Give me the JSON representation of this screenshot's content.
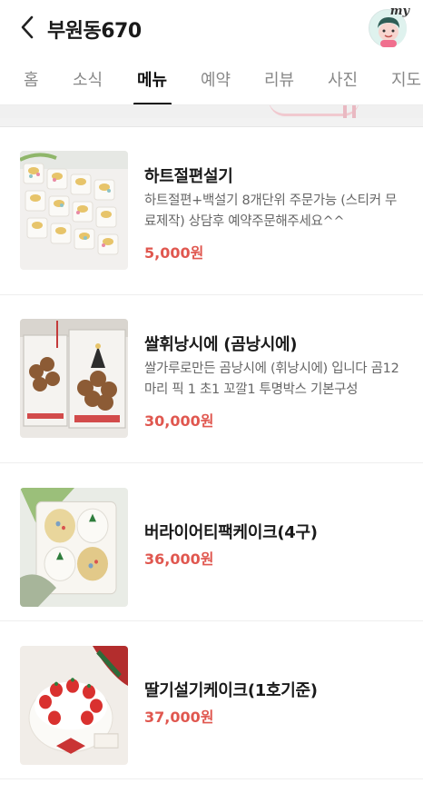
{
  "header": {
    "title": "부원동670",
    "back_icon": "chevron-left-icon",
    "avatar_badge": "my"
  },
  "tabs": [
    {
      "label": "홈",
      "active": false
    },
    {
      "label": "소식",
      "active": false
    },
    {
      "label": "메뉴",
      "active": true
    },
    {
      "label": "예약",
      "active": false
    },
    {
      "label": "리뷰",
      "active": false
    },
    {
      "label": "사진",
      "active": false
    },
    {
      "label": "지도",
      "active": false
    }
  ],
  "menu": {
    "items": [
      {
        "name": "하트절편설기",
        "description": "하트절편+백설기 8개단위 주문가능 (스티커 무료제작) 상담후 예약주문해주세요^^",
        "price": "5,000원"
      },
      {
        "name": "쌀휘낭시에 (곰낭시에)",
        "description": "쌀가루로만든 곰낭시에 (휘낭시에) 입니다 곰12마리 픽 1 초1 꼬깔1 투명박스 기본구성",
        "price": "30,000원"
      },
      {
        "name": "버라이어티팩케이크(4구)",
        "description": "",
        "price": "36,000원"
      },
      {
        "name": "딸기설기케이크(1호기준)",
        "description": "",
        "price": "37,000원"
      }
    ]
  },
  "colors": {
    "price": "#e0574f",
    "active_tab": "#111111",
    "inactive_tab": "#888888"
  }
}
